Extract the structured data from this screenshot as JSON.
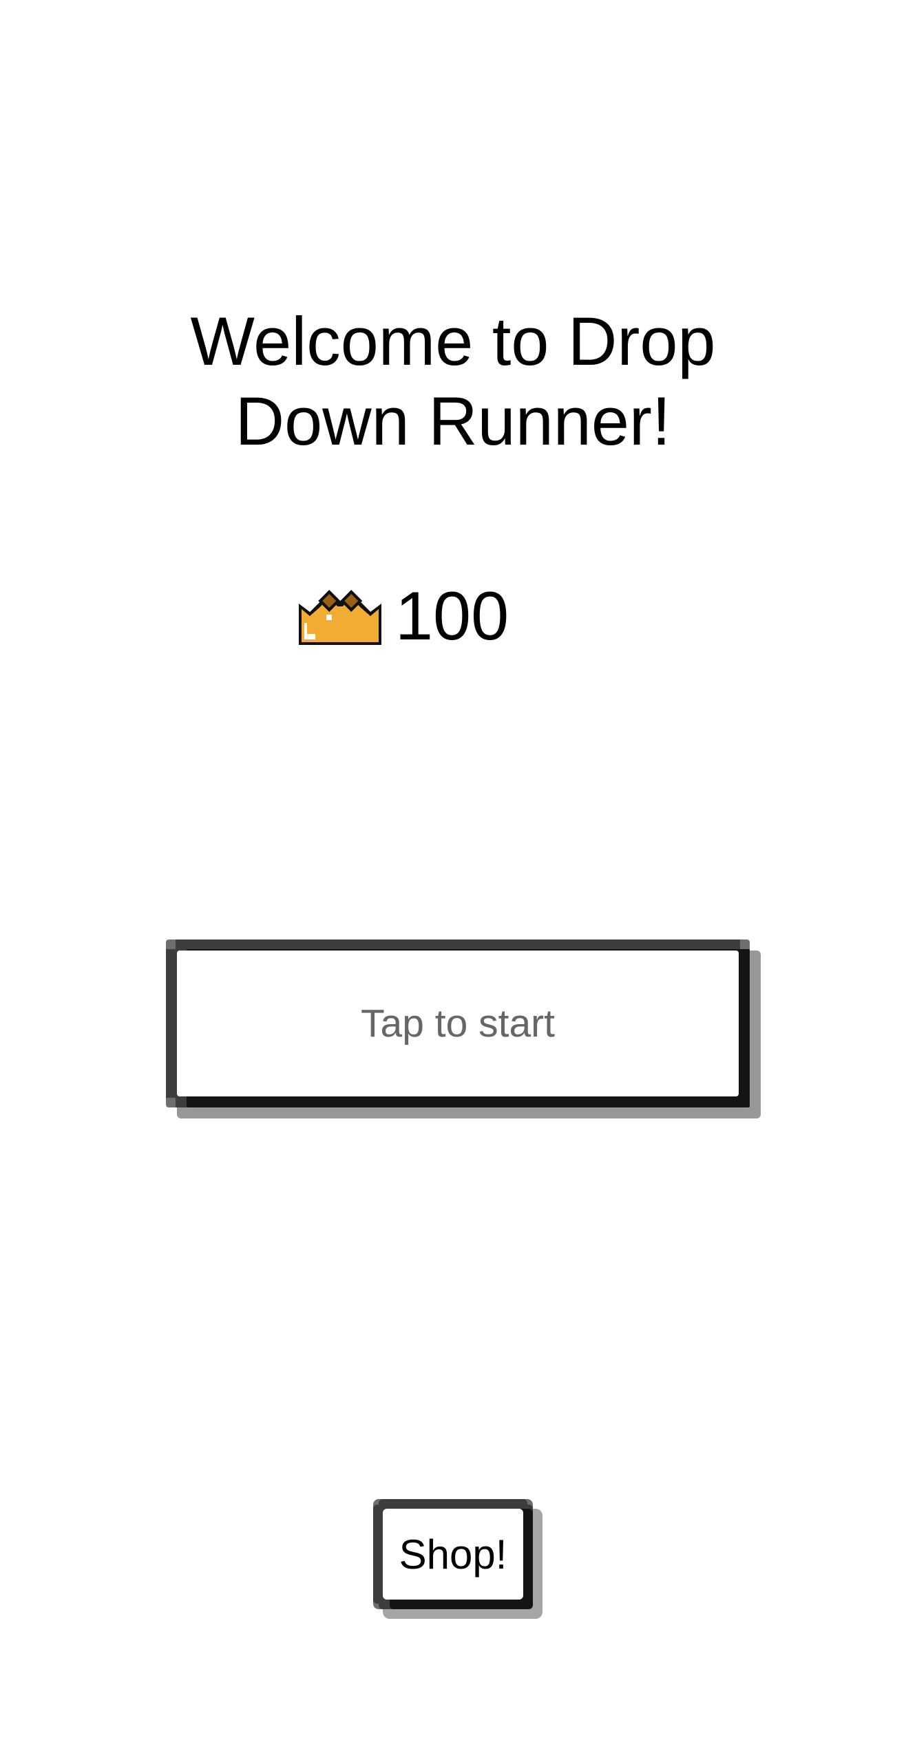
{
  "welcome": {
    "title_line1": "Welcome to Drop",
    "title_line2": "Down Runner!"
  },
  "score": {
    "icon": "crown-icon",
    "value": "100"
  },
  "start_button": {
    "label": "Tap to start"
  },
  "shop_button": {
    "label": "Shop!"
  },
  "colors": {
    "background": "#ffffff",
    "text": "#000000",
    "start_label": "#666666",
    "crown_gold": "#f2ab33",
    "crown_gem": "#9a5f16"
  }
}
